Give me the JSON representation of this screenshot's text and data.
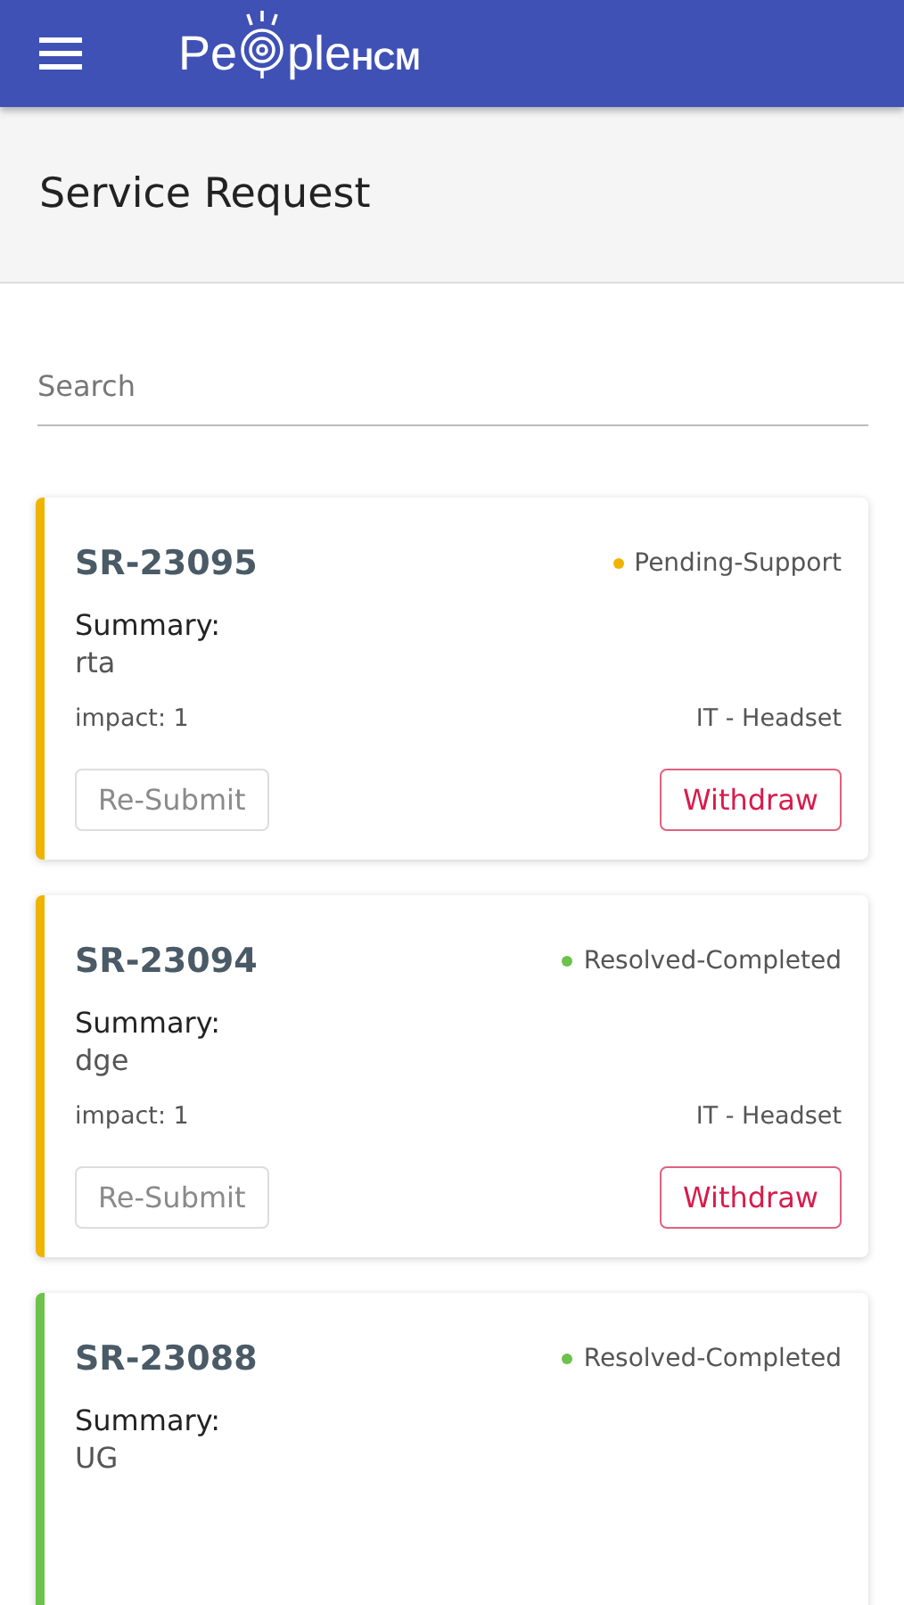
{
  "app_bar": {
    "logo": {
      "before": "Pe",
      "after": "ple",
      "suffix": "HCM"
    }
  },
  "page_title": "Service Request",
  "search": {
    "placeholder": "Search"
  },
  "requests": [
    {
      "id": "SR-23095",
      "color": "#f0b400",
      "status": {
        "label": "Pending-Support",
        "color": "#f0b400"
      },
      "summary_label": "Summary:",
      "summary": "rta",
      "impact": "impact: 1",
      "category": "IT - Headset",
      "buttons": [
        {
          "label": "Re-Submit",
          "kind": "secondary",
          "disabled": true
        },
        {
          "label": "Withdraw",
          "kind": "danger",
          "disabled": false
        }
      ]
    },
    {
      "id": "SR-23094",
      "color": "#f0b400",
      "status": {
        "label": "Resolved-Completed",
        "color": "#6cc24a"
      },
      "summary_label": "Summary:",
      "summary": "dge",
      "impact": "impact: 1",
      "category": "IT - Headset",
      "buttons": [
        {
          "label": "Re-Submit",
          "kind": "secondary",
          "disabled": true
        },
        {
          "label": "Withdraw",
          "kind": "danger",
          "disabled": false
        }
      ]
    },
    {
      "id": "SR-23088",
      "color": "#6cc24a",
      "status": {
        "label": "Resolved-Completed",
        "color": "#6cc24a"
      },
      "summary_label": "Summary:",
      "summary": "UG"
    }
  ]
}
